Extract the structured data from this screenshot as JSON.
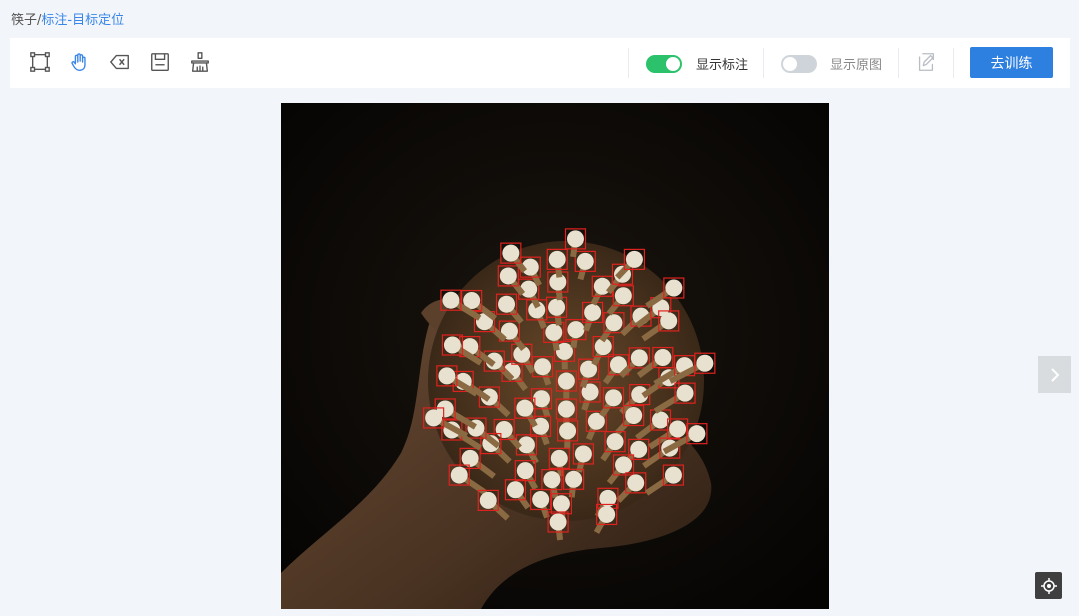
{
  "breadcrumb": {
    "root": "筷子/",
    "current": "标注-目标定位"
  },
  "toolbar": {
    "tools": [
      {
        "icon": "rectangle-select-icon"
      },
      {
        "icon": "hand-pan-icon"
      },
      {
        "icon": "delete-icon"
      },
      {
        "icon": "save-icon"
      },
      {
        "icon": "clear-brush-icon"
      }
    ],
    "show_annotation": {
      "label": "显示标注",
      "on": true
    },
    "show_original": {
      "label": "显示原图",
      "on": false
    },
    "edit_icon": "edit-icon",
    "train_button": "去训练"
  },
  "colors": {
    "accent": "#2d7fe0",
    "switch_on": "#2bc26b",
    "box": "#e0221e",
    "link": "#3a86e8"
  },
  "canvas": {
    "image": "chopstick-bundle-photo",
    "next_icon": "chevron-right-icon",
    "locate_icon": "locate-icon"
  }
}
